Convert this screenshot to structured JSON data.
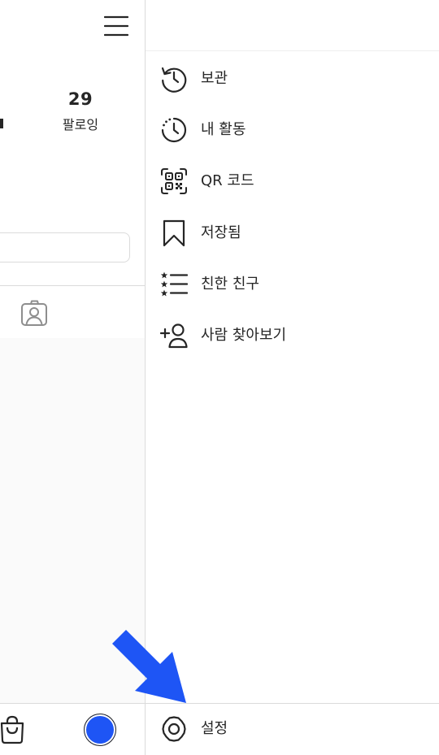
{
  "profile": {
    "following_count": "29",
    "following_label": "팔로잉"
  },
  "menu": {
    "items": [
      {
        "label": "보관",
        "icon": "archive-history-icon"
      },
      {
        "label": "내 활동",
        "icon": "activity-clock-icon"
      },
      {
        "label": "QR 코드",
        "icon": "qr-code-icon"
      },
      {
        "label": "저장됨",
        "icon": "bookmark-icon"
      },
      {
        "label": "친한 친구",
        "icon": "close-friends-list-icon"
      },
      {
        "label": "사람 찾아보기",
        "icon": "add-person-icon"
      }
    ],
    "settings_label": "설정",
    "settings_icon": "gear-icon"
  },
  "colors": {
    "arrow": "#1e55f5",
    "avatar": "#1e55f5",
    "text": "#262626",
    "divider": "#dbdbdb"
  }
}
